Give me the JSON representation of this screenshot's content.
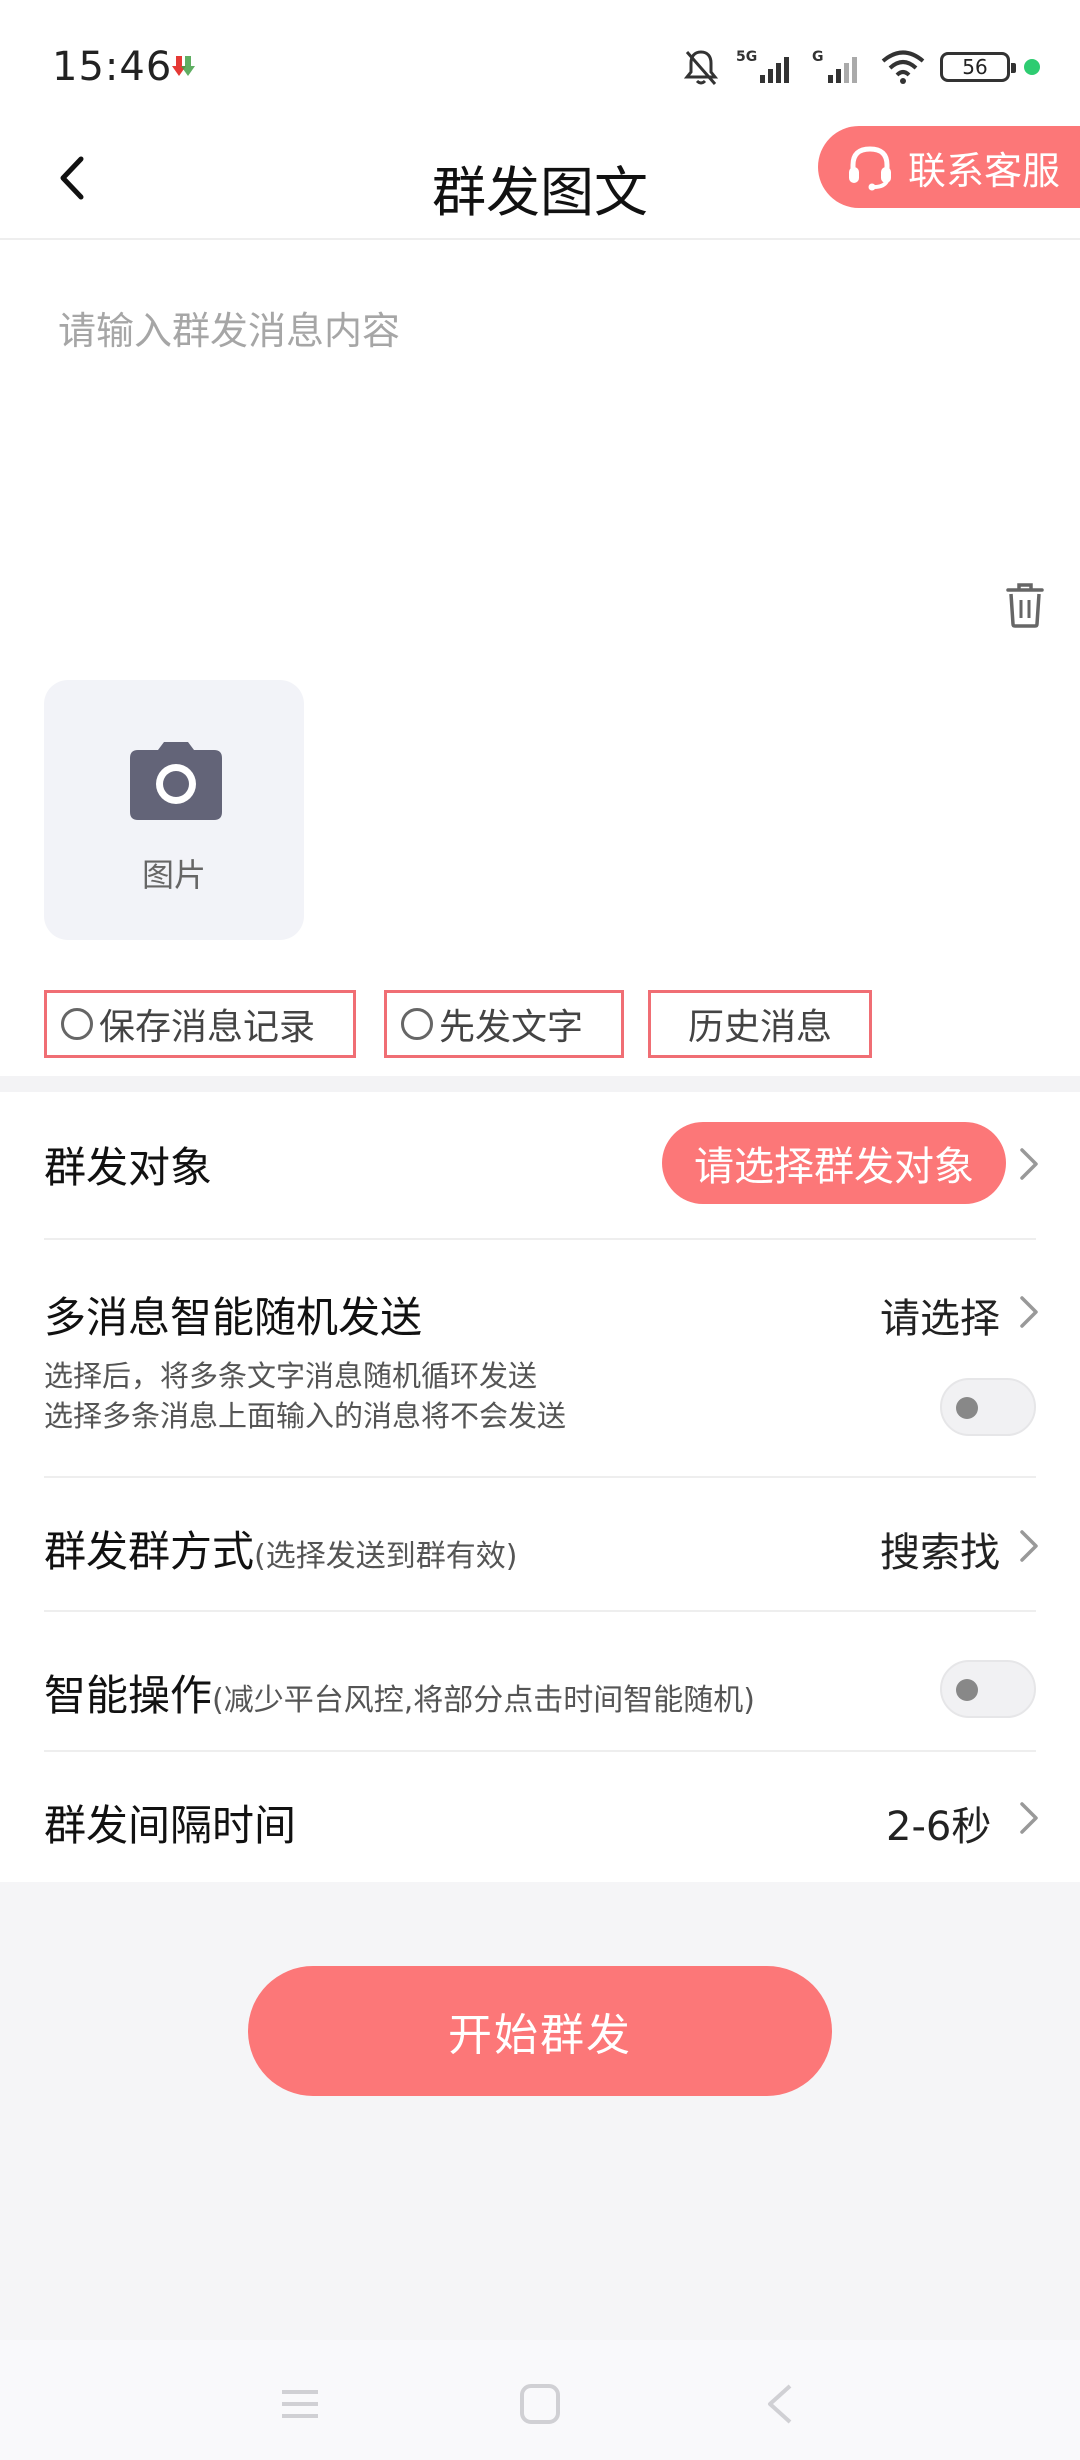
{
  "status_bar": {
    "time": "15:46",
    "battery": "56",
    "icons": [
      "download-app-icon",
      "mute-bell-icon",
      "signal-5g-icon",
      "signal-g-icon",
      "wifi-icon",
      "battery-icon"
    ]
  },
  "header": {
    "title": "群发图文",
    "service_label": "联系客服"
  },
  "editor": {
    "placeholder": "请输入群发消息内容",
    "value": "",
    "image_label": "图片"
  },
  "options": {
    "save_history": "保存消息记录",
    "send_text_first": "先发文字",
    "history": "历史消息"
  },
  "settings": {
    "target": {
      "label": "群发对象",
      "button": "请选择群发对象"
    },
    "random": {
      "label": "多消息智能随机发送",
      "value": "请选择",
      "hint1": "选择后，将多条文字消息随机循环发送",
      "hint2": "选择多条消息上面输入的消息将不会发送",
      "enabled": false
    },
    "mode": {
      "label": "群发群方式",
      "note": "(选择发送到群有效)",
      "value": "搜索找"
    },
    "smart": {
      "label": "智能操作",
      "note": "(减少平台风控,将部分点击时间智能随机)",
      "enabled": false
    },
    "interval": {
      "label": "群发间隔时间",
      "value": "2-6秒"
    }
  },
  "actions": {
    "start": "开始群发"
  },
  "colors": {
    "accent": "#fc7778",
    "chip_border": "#f06e74",
    "page_bg": "#f5f5f7"
  }
}
